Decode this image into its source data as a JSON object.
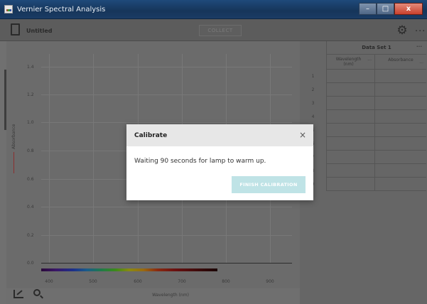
{
  "window": {
    "title": "Vernier Spectral Analysis",
    "minimize": "–",
    "maximize": "□",
    "close": "x"
  },
  "toolbar": {
    "document_title": "Untitled",
    "collect_label": "COLLECT",
    "gear_icon": "⚙",
    "more_icon": "···"
  },
  "graph": {
    "y_ticks": [
      "1.4",
      "1.2",
      "1.0",
      "0.8",
      "0.6",
      "0.4",
      "0.2",
      "0.0"
    ],
    "x_ticks": [
      "400",
      "500",
      "600",
      "700",
      "800",
      "900"
    ],
    "x_label": "Wavelength (nm)",
    "y_label": "Absorbance"
  },
  "table": {
    "dataset_title": "Data Set 1",
    "dataset_more": "···",
    "columns": [
      {
        "label": "Wavelength (nm)",
        "more": "···"
      },
      {
        "label": "Absorbance",
        "more": "···"
      }
    ],
    "row_numbers": [
      "1",
      "2",
      "3",
      "4",
      "5",
      "6",
      "7",
      "8",
      "9"
    ]
  },
  "dialog": {
    "title": "Calibrate",
    "close_icon": "×",
    "message": "Waiting 90 seconds for lamp to warm up.",
    "button_label": "FINISH CALIBRATION"
  }
}
